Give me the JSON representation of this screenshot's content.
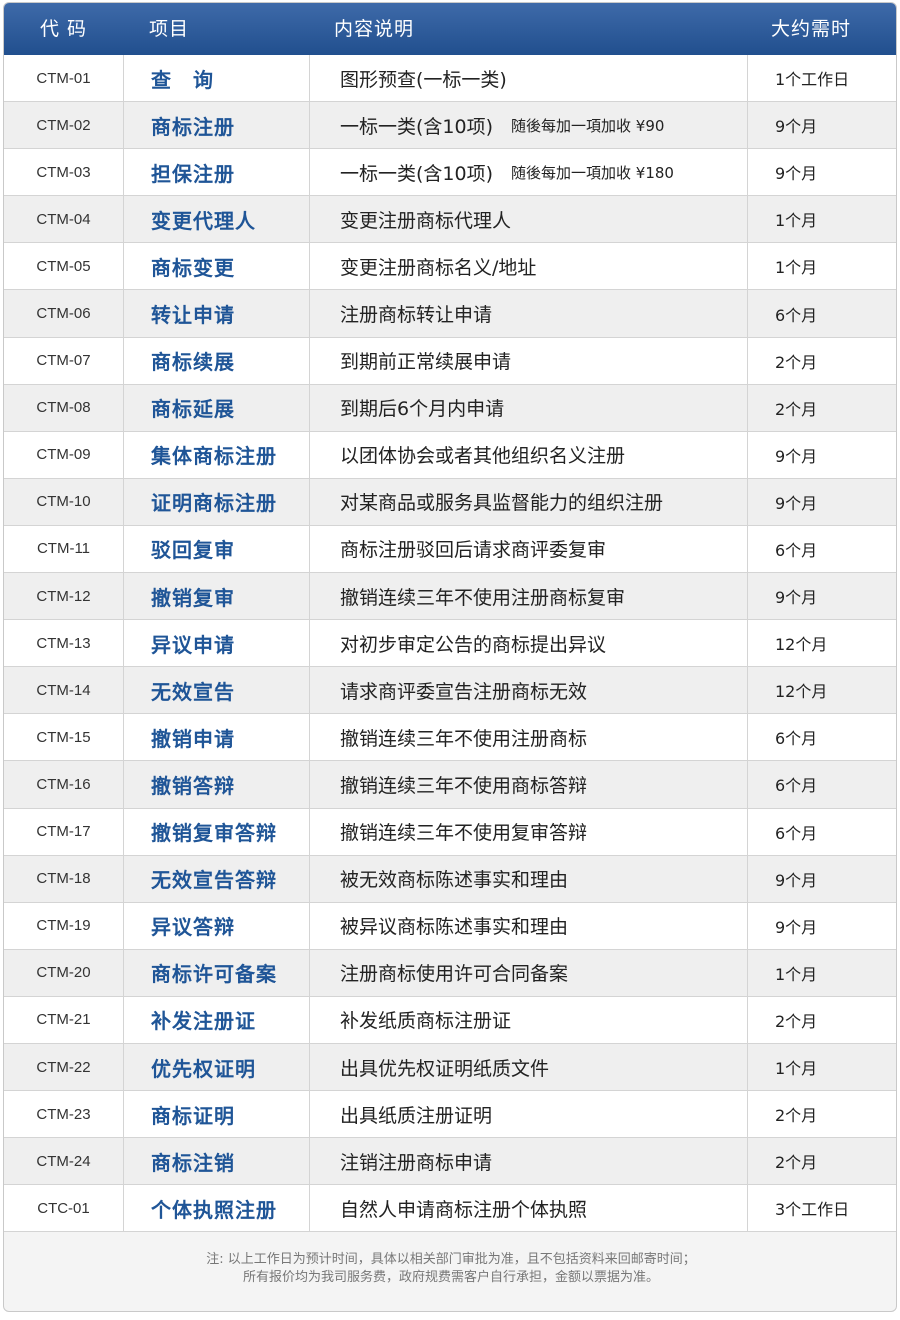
{
  "header": {
    "code": "代 码",
    "item": "项目",
    "desc": "内容说明",
    "time": "大约需时"
  },
  "rows": [
    {
      "code": "CTM-01",
      "name": "查　询",
      "desc": "图形预查(一标一类)",
      "extra": "",
      "time": "1个工作日"
    },
    {
      "code": "CTM-02",
      "name": "商标注册",
      "desc": "一标一类(含10项)",
      "extra": "随後每加一項加收 ¥90",
      "time": "9个月"
    },
    {
      "code": "CTM-03",
      "name": "担保注册",
      "desc": "一标一类(含10项)",
      "extra": "随後每加一項加收 ¥180",
      "time": "9个月"
    },
    {
      "code": "CTM-04",
      "name": "变更代理人",
      "desc": "变更注册商标代理人",
      "extra": "",
      "time": "1个月"
    },
    {
      "code": "CTM-05",
      "name": "商标变更",
      "desc": "变更注册商标名义/地址",
      "extra": "",
      "time": "1个月"
    },
    {
      "code": "CTM-06",
      "name": "转让申请",
      "desc": "注册商标转让申请",
      "extra": "",
      "time": "6个月"
    },
    {
      "code": "CTM-07",
      "name": "商标续展",
      "desc": "到期前正常续展申请",
      "extra": "",
      "time": "2个月"
    },
    {
      "code": "CTM-08",
      "name": "商标延展",
      "desc": "到期后6个月内申请",
      "extra": "",
      "time": "2个月"
    },
    {
      "code": "CTM-09",
      "name": "集体商标注册",
      "desc": "以团体协会或者其他组织名义注册",
      "extra": "",
      "time": "9个月"
    },
    {
      "code": "CTM-10",
      "name": "证明商标注册",
      "desc": "对某商品或服务具监督能力的组织注册",
      "extra": "",
      "time": "9个月"
    },
    {
      "code": "CTM-11",
      "name": "驳回复审",
      "desc": "商标注册驳回后请求商评委复审",
      "extra": "",
      "time": "6个月"
    },
    {
      "code": "CTM-12",
      "name": "撤销复审",
      "desc": "撤销连续三年不使用注册商标复审",
      "extra": "",
      "time": "9个月"
    },
    {
      "code": "CTM-13",
      "name": "异议申请",
      "desc": "对初步审定公告的商标提出异议",
      "extra": "",
      "time": "12个月"
    },
    {
      "code": "CTM-14",
      "name": "无效宣告",
      "desc": "请求商评委宣告注册商标无效",
      "extra": "",
      "time": "12个月"
    },
    {
      "code": "CTM-15",
      "name": "撤销申请",
      "desc": "撤销连续三年不使用注册商标",
      "extra": "",
      "time": "6个月"
    },
    {
      "code": "CTM-16",
      "name": "撤销答辩",
      "desc": "撤销连续三年不使用商标答辩",
      "extra": "",
      "time": "6个月"
    },
    {
      "code": "CTM-17",
      "name": "撤销复审答辩",
      "desc": "撤销连续三年不使用复审答辩",
      "extra": "",
      "time": "6个月"
    },
    {
      "code": "CTM-18",
      "name": "无效宣告答辩",
      "desc": "被无效商标陈述事实和理由",
      "extra": "",
      "time": "9个月"
    },
    {
      "code": "CTM-19",
      "name": "异议答辩",
      "desc": "被异议商标陈述事实和理由",
      "extra": "",
      "time": "9个月"
    },
    {
      "code": "CTM-20",
      "name": "商标许可备案",
      "desc": "注册商标使用许可合同备案",
      "extra": "",
      "time": "1个月"
    },
    {
      "code": "CTM-21",
      "name": "补发注册证",
      "desc": "补发纸质商标注册证",
      "extra": "",
      "time": "2个月"
    },
    {
      "code": "CTM-22",
      "name": "优先权证明",
      "desc": "出具优先权证明纸质文件",
      "extra": "",
      "time": "1个月"
    },
    {
      "code": "CTM-23",
      "name": "商标证明",
      "desc": "出具纸质注册证明",
      "extra": "",
      "time": "2个月"
    },
    {
      "code": "CTM-24",
      "name": "商标注销",
      "desc": "注销注册商标申请",
      "extra": "",
      "time": "2个月"
    },
    {
      "code": "CTC-01",
      "name": "个体执照注册",
      "desc": "自然人申请商标注册个体执照",
      "extra": "",
      "time": "3个工作日"
    }
  ],
  "note": {
    "line1": "注: 以上工作日为预计时间，具体以相关部门审批为准，且不包括资料来回邮寄时间；",
    "line2": "所有报价均为我司服务费，政府规费需客户自行承担，金额以票据为准。"
  }
}
